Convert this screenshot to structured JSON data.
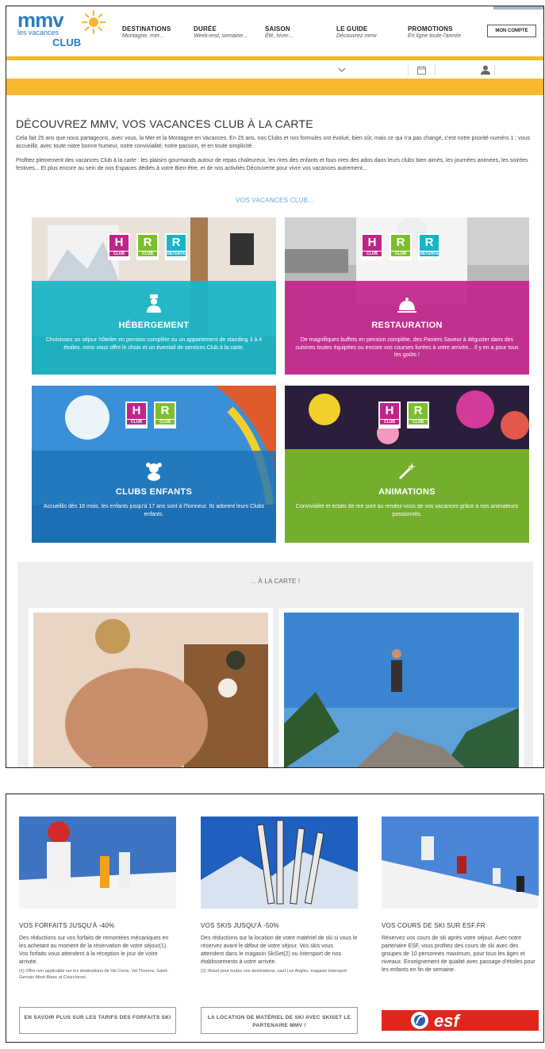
{
  "header": {
    "logo_brand": "mmv",
    "logo_line1": "les vacances",
    "logo_line2": "CLUB",
    "nav": [
      {
        "title": "DESTINATIONS",
        "subtitle": "Montagne, mer..."
      },
      {
        "title": "DURÉE",
        "subtitle": "Week-end, semaine..."
      },
      {
        "title": "SAISON",
        "subtitle": "Été, hiver..."
      },
      {
        "title": "LE GUIDE",
        "subtitle": "Découvrez mmv"
      },
      {
        "title": "PROMOTIONS",
        "subtitle": "En ligne toute l'année"
      }
    ],
    "account_label": "MON COMPTE"
  },
  "colors": {
    "accent_yellow": "#f7b731",
    "brand_blue": "#2a7ec1",
    "cyan_band": "#17b5c8",
    "magenta_band": "#c0248a",
    "blue_band": "#1e74b8",
    "green_band": "#7cbf2a"
  },
  "intro": {
    "title": "DÉCOUVREZ MMV, VOS VACANCES CLUB À LA CARTE",
    "p1": "Cela fait 25 ans que nous partageons, avec vous, la Mer et la Montagne en Vacances. En 25 ans, nos Clubs et nos formules ont évolué, bien sûr, mais ce qui n'a pas changé, c'est notre priorité numéro 1 : vous accueillir, avec toute notre bonne humeur, notre convivialité, notre passion, et en toute simplicité.",
    "p2": "Profitez pleinement des vacances Club à la carte : les plaisirs gourmands autour de repas chaleureux, les rires des enfants et fous rires des ados dans leurs clubs bien aimés, les journées animées, les soirées festives... Et plus encore au sein de nos Espaces dédiés à votre Bien-être, et de nos activités Découverte pour vivre vos vacances autrement...",
    "section_link": "VOS VACANCES CLUB..."
  },
  "badges": {
    "h_letter": "H",
    "h_label": "CLUB",
    "r_letter": "R",
    "r_label": "CLUB",
    "rd_letter": "R",
    "rd_label": "DÉTENTE"
  },
  "tiles": [
    {
      "title": "HÉBERGEMENT",
      "icon": "bellhop-icon",
      "desc": "Choisissez un séjour hôtelier en pension complète ou un appartement de standing 3 à 4 étoiles. mmv vous offre le choix et un éventail de services Club à la carte."
    },
    {
      "title": "RESTAURATION",
      "icon": "cloche-icon",
      "desc": "De magnifiques buffets en pension complète, des Paniers Saveur à déguster dans des cuisines toutes équipées ou encore vos courses livrées à votre arrivée... Il y en a pour tous les goûts !"
    },
    {
      "title": "CLUBS ENFANTS",
      "icon": "teddy-bear-icon",
      "desc": "Accueillis dès 18 mois, les enfants jusqu'à 17 ans sont à l'honneur. Ils adorent leurs Clubs enfants."
    },
    {
      "title": "ANIMATIONS",
      "icon": "magic-wand-icon",
      "desc": "Convivialité et éclats de rire sont au rendez-vous de vos vacances grâce à nos animateurs passionnés."
    }
  ],
  "carte": {
    "title": "... À LA CARTE !"
  },
  "offers": [
    {
      "title": "VOS FORFAITS JUSQU'À -40%",
      "text": "Des réductions sur vos forfaits de remontées mécaniques en les achetant au moment de la réservation de votre séjour(1). Vos forfaits vous attendent à la réception le jour de votre arrivée.",
      "note": "(1) Offre non applicable sur les destinations de Val Cenis, Val Thorens, Saint-Gervais Mont-Blanc et Courchevel.",
      "button": "EN SAVOIR PLUS SUR LES TARIFS DES FORFAITS SKI"
    },
    {
      "title": "VOS SKIS JUSQU'À -50%",
      "text": "Des réductions sur la location de votre matériel de ski si vous le réservez avant le début de votre séjour. Vos skis vous attendent dans le magasin SkiSet(2) ou Intersport de nos établissements à votre arrivée.",
      "note": "(2) Skiset pour toutes nos destinations, sauf Les Angles, magasin Intersport",
      "button": "LA LOCATION DE MATÉRIEL DE SKI AVEC SKISET LE PARTENAIRE MMV !"
    },
    {
      "title": "VOS COURS DE SKI SUR ESF.FR",
      "text": "Réservez vos cours de ski après votre séjour. Avec notre partenaire ESF, vous profitez des cours de ski avec des groupes de 10 personnes maximum, pour tous les âges et niveaux. Enseignement de qualité avec passage d'étoiles pour les enfants en fin de semaine.",
      "note": "",
      "button": ""
    }
  ],
  "esf_logo_text": "esf"
}
